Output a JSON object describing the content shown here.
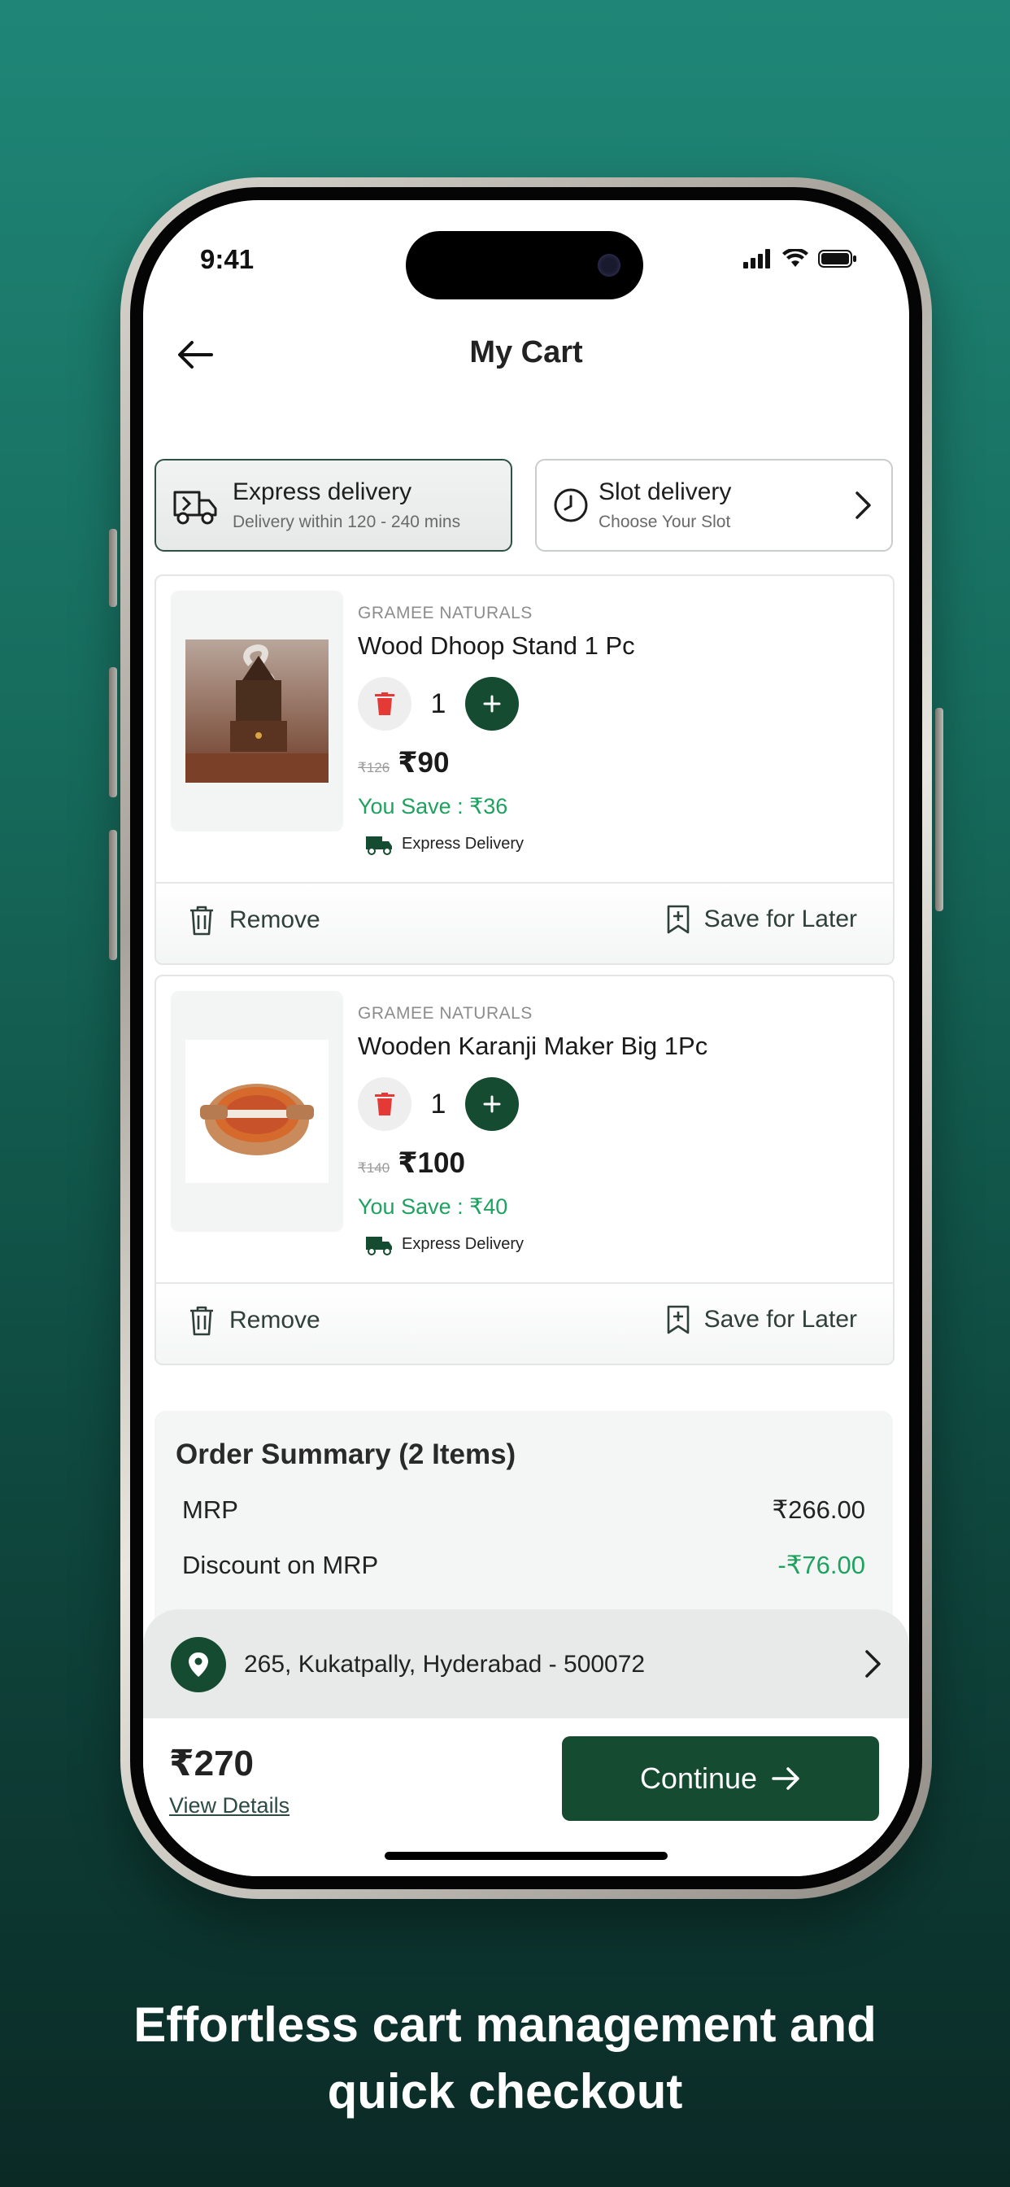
{
  "status_bar": {
    "time": "9:41"
  },
  "header": {
    "title": "My Cart"
  },
  "delivery_options": {
    "express": {
      "title": "Express delivery",
      "subtitle": "Delivery within  120 - 240 mins"
    },
    "slot": {
      "title": "Slot delivery",
      "subtitle": "Choose Your Slot"
    }
  },
  "items": [
    {
      "brand": "GRAMEE NATURALS",
      "name": "Wood Dhoop Stand 1 Pc",
      "quantity": "1",
      "mrp": "₹126",
      "price": "₹90",
      "you_save": "You Save : ₹36",
      "delivery_tag": "Express Delivery",
      "remove_label": "Remove",
      "save_label": "Save for Later"
    },
    {
      "brand": "GRAMEE NATURALS",
      "name": "Wooden Karanji Maker Big 1Pc",
      "quantity": "1",
      "mrp": "₹140",
      "price": "₹100",
      "you_save": "You Save : ₹40",
      "delivery_tag": "Express Delivery",
      "remove_label": "Remove",
      "save_label": "Save for Later"
    }
  ],
  "order_summary": {
    "title": "Order Summary (2 Items)",
    "rows": [
      {
        "label": "MRP",
        "value": "₹266.00"
      },
      {
        "label": "Discount on MRP",
        "value": "-₹76.00"
      }
    ]
  },
  "address": {
    "text": "265, Kukatpally, Hyderabad - 500072"
  },
  "checkout": {
    "total": "₹270",
    "view_details": "View Details",
    "continue_label": "Continue"
  },
  "caption": {
    "line1": "Effortless cart management and",
    "line2": "quick checkout"
  },
  "colors": {
    "brand_green": "#154b30",
    "save_green": "#1ea25f",
    "delete_red": "#e53935",
    "background_teal": "#1f8677"
  }
}
